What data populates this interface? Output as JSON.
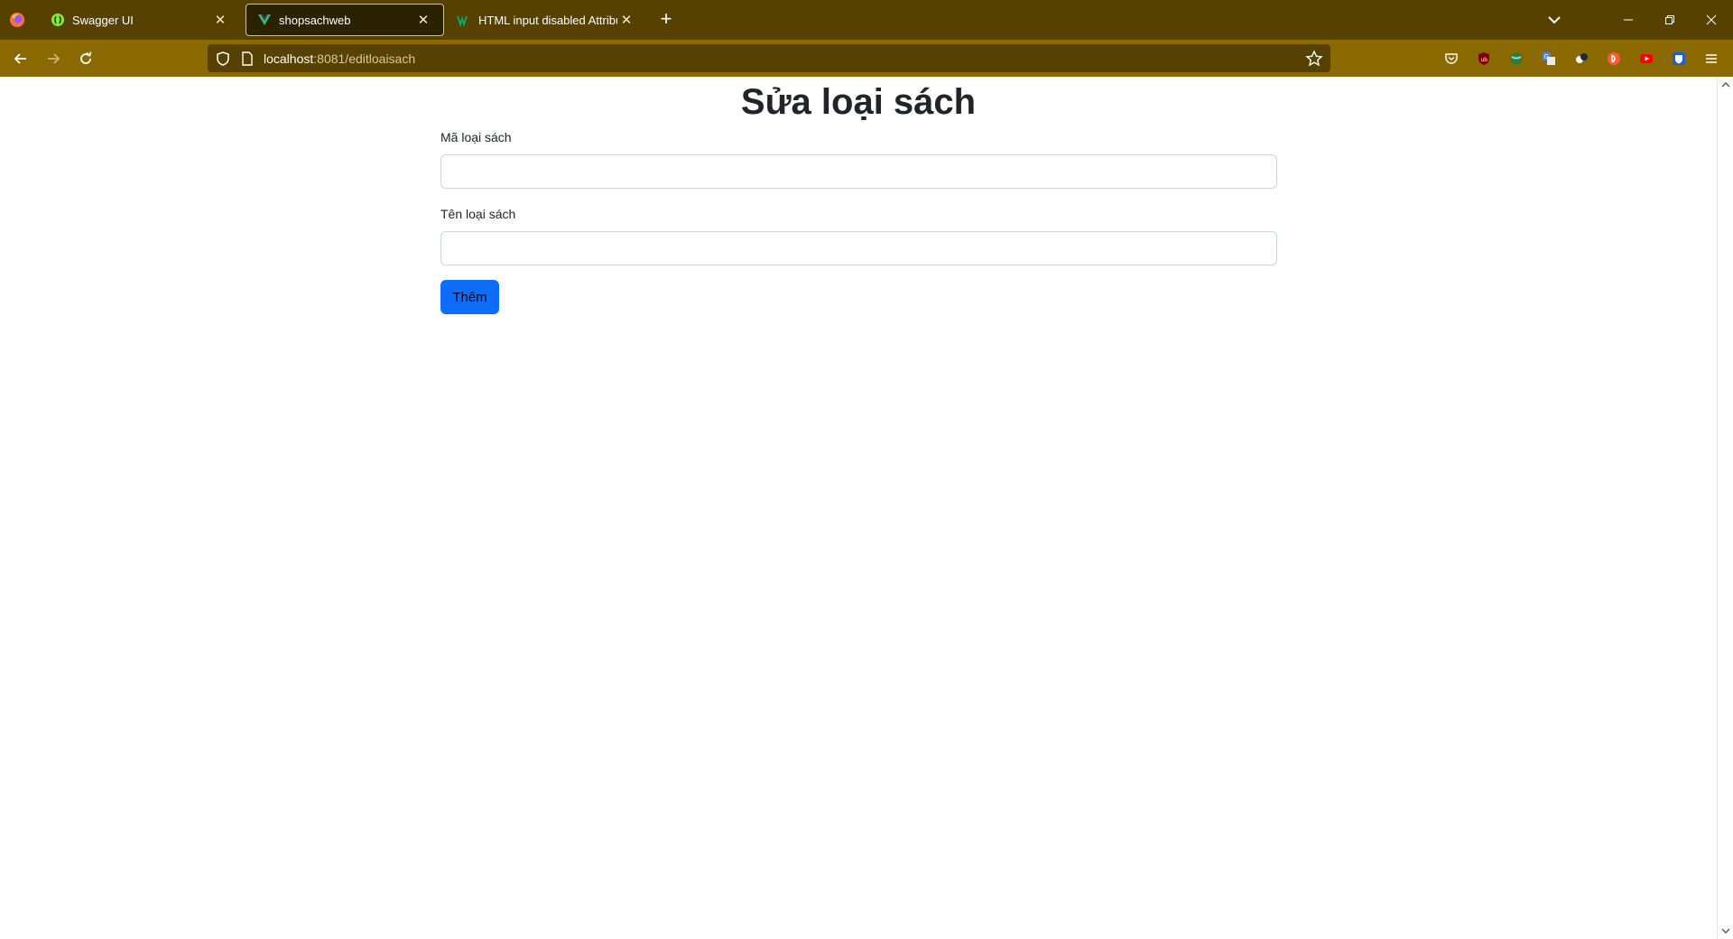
{
  "browser": {
    "tabs": [
      {
        "title": "Swagger UI",
        "icon": "swagger-icon",
        "active": false
      },
      {
        "title": "shopsachweb",
        "icon": "vue-icon",
        "active": true
      },
      {
        "title": "HTML input disabled Attribute",
        "icon": "w3schools-icon",
        "active": false
      }
    ],
    "url_host": "localhost",
    "url_rest": ":8081/editloaisach"
  },
  "form": {
    "title": "Sửa loại sách",
    "ma_label": "Mã loại sách",
    "ma_value": "",
    "ten_label": "Tên loại sách",
    "ten_value": "",
    "submit_label": "Thêm"
  },
  "colors": {
    "tabstrip": "#574100",
    "navbar": "#8a6a00",
    "primary_button": "#0d6efd"
  }
}
